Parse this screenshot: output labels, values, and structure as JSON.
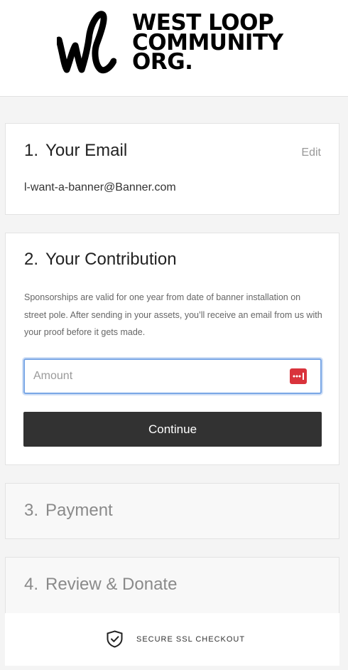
{
  "header": {
    "logo_lines": [
      "WEST LOOP",
      "COMMUNITY",
      "ORG."
    ]
  },
  "steps": {
    "email": {
      "number": "1.",
      "title": "Your Email",
      "edit_label": "Edit",
      "value": "l-want-a-banner@Banner.com"
    },
    "contribution": {
      "number": "2.",
      "title": "Your Contribution",
      "description": "Sponsorships are valid for one year from date of banner installation on street pole. After sending in your assets, you’ll receive an email from us with your proof before it gets made.",
      "amount_placeholder": "Amount",
      "amount_value": "",
      "continue_label": "Continue"
    },
    "payment": {
      "number": "3.",
      "title": "Payment"
    },
    "review": {
      "number": "4.",
      "title": "Review & Donate"
    }
  },
  "footer": {
    "ssl_label": "SECURE SSL CHECKOUT"
  },
  "colors": {
    "accent_focus": "#7aa7e6",
    "button_bg": "#323232",
    "password_manager_icon": "#d9333c"
  }
}
